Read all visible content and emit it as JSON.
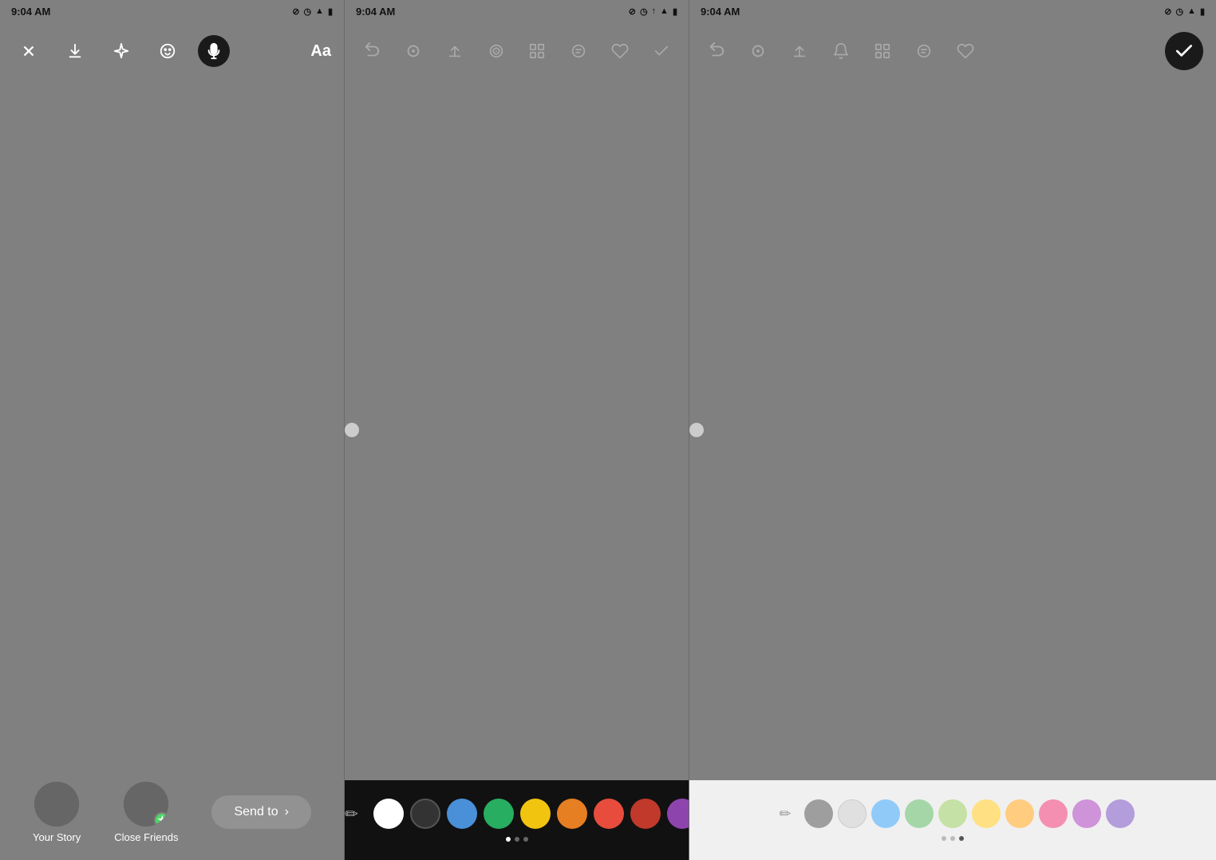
{
  "panels": [
    {
      "id": "left",
      "status": {
        "time": "9:04 AM",
        "icons": [
          "notification",
          "clock",
          "wifi",
          "battery"
        ]
      },
      "toolbar": {
        "buttons": [
          {
            "name": "close",
            "icon": "close"
          },
          {
            "name": "download",
            "icon": "download"
          },
          {
            "name": "sparkle",
            "icon": "sparkle"
          },
          {
            "name": "face",
            "icon": "face"
          },
          {
            "name": "audio",
            "icon": "audio",
            "active": true
          },
          {
            "name": "text",
            "label": "Aa"
          }
        ]
      },
      "bottom": {
        "stories": [
          {
            "name": "Your Story",
            "hasAvatar": true,
            "hasBadge": false
          },
          {
            "name": "Close Friends",
            "hasAvatar": true,
            "hasBadge": true
          }
        ],
        "sendButton": "Send to"
      }
    },
    {
      "id": "mid",
      "status": {
        "time": "9:04 AM"
      },
      "toolbar": {
        "undo": true,
        "tools": [
          "pencil-tip",
          "upload",
          "layer",
          "grid",
          "text-align",
          "heart",
          "check"
        ]
      },
      "palette": {
        "dark": true,
        "colors": [
          "#fff",
          "#333",
          "#4a90d9",
          "#27ae60",
          "#f1c40f",
          "#e67e22",
          "#e74c3c",
          "#c0392b",
          "#8e44ad"
        ],
        "hasPenIcon": true,
        "dots": [
          true,
          false,
          false
        ]
      }
    },
    {
      "id": "right",
      "status": {
        "time": "9:04 AM"
      },
      "toolbar": {
        "undo": true,
        "tools": [
          "pencil-tip",
          "upload",
          "bell",
          "grid",
          "text-align",
          "heart"
        ],
        "hasCheck": true
      },
      "palette": {
        "dark": false,
        "colors": [
          "#9e9e9e",
          "#e0e0e0",
          "#90caf9",
          "#a5d6a7",
          "#c5e1a5",
          "#ffe082",
          "#ffcc80",
          "#f48fb1",
          "#ce93d8",
          "#b39ddb"
        ],
        "hasPenIcon": true,
        "dots": [
          false,
          false,
          true
        ]
      }
    }
  ],
  "colors": {
    "panel_bg": "#808080",
    "toolbar_bg": "transparent",
    "palette_dark": "#111111",
    "palette_light": "#f0f0f0",
    "active_button": "#1a1a1a",
    "check_bg": "#1a1a1a",
    "send_btn_bg": "rgba(200,200,200,0.25)",
    "badge_green": "#4cd964"
  },
  "icons": {
    "close": "✕",
    "download": "⬇",
    "sparkle": "✦",
    "face": "☺",
    "audio": "🎙",
    "undo": "↩",
    "check": "✓",
    "pen": "✏"
  }
}
